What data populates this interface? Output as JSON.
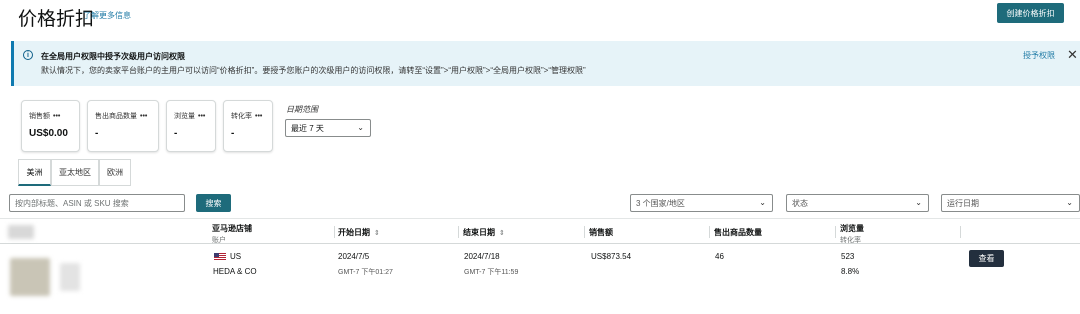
{
  "header": {
    "title": "价格折扣",
    "learn_more": "了解更多信息",
    "create_button": "创建价格折扣"
  },
  "banner": {
    "title": "在全局用户权限中授予次级用户访问权限",
    "text": "默认情况下，您的卖家平台账户的主用户可以访问“价格折扣”。要授予您账户的次级用户的访问权限，请转至“设置”>“用户权限”>“全局用户权限”>“管理权限”",
    "action": "授予权限",
    "close": "✕",
    "info_icon": "i"
  },
  "metrics": [
    {
      "label": "销售额",
      "value": "US$0.00"
    },
    {
      "label": "售出商品数量",
      "value": "-"
    },
    {
      "label": "浏览量",
      "value": "-"
    },
    {
      "label": "转化率",
      "value": "-"
    }
  ],
  "metric_menu": "•••",
  "date_range": {
    "label": "日期范围",
    "selected": "最近 7 天"
  },
  "tabs": [
    {
      "label": "美洲",
      "active": true
    },
    {
      "label": "亚太地区",
      "active": false
    },
    {
      "label": "欧洲",
      "active": false
    }
  ],
  "search": {
    "placeholder": "按内部标题、ASIN 或 SKU 搜索",
    "button": "搜索"
  },
  "filters": {
    "country": "3 个国家/地区",
    "status": "状态",
    "run_date": "运行日期"
  },
  "table": {
    "headers": {
      "store": "亚马逊店铺",
      "store_sub": "账户",
      "start": "开始日期",
      "end": "结束日期",
      "sales": "销售额",
      "units": "售出商品数量",
      "views": "浏览量",
      "conversion_sub": "转化率"
    },
    "row": {
      "marketplace": "US",
      "account": "HEDA & CO",
      "start_date": "2024/7/5",
      "start_time": "GMT-7 下午01:27",
      "end_date": "2024/7/18",
      "end_time": "GMT-7 下午11:59",
      "sales": "US$873.54",
      "units": "46",
      "views": "523",
      "conversion": "8.8%",
      "view_button": "查看"
    }
  },
  "colors": {
    "accent": "#1e6b7b",
    "banner_bg": "#e6f3f8",
    "banner_border": "#0f7ab0",
    "link": "#1e7aa5",
    "dark_button": "#232f3e"
  }
}
